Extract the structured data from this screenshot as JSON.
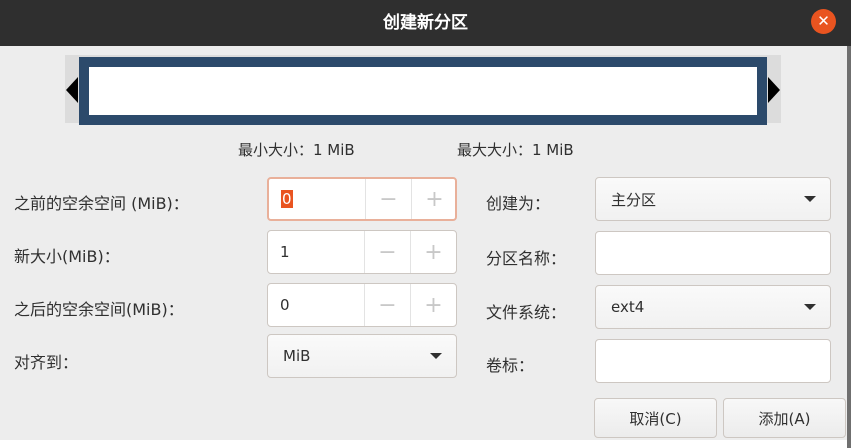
{
  "window": {
    "title": "创建新分区",
    "close_glyph": "✕",
    "accent": "#e95420"
  },
  "size_info": {
    "min": "最小大小：1 MiB",
    "max": "最大大小：1 MiB"
  },
  "fields": {
    "free_before": {
      "label": "之前的空余空间 (MiB)：",
      "value": "0",
      "minus": "−",
      "plus": "+"
    },
    "new_size": {
      "label": "新大小(MiB)：",
      "value": "1",
      "minus": "−",
      "plus": "+"
    },
    "free_after": {
      "label": "之后的空余空间(MiB)：",
      "value": "0",
      "minus": "−",
      "plus": "+"
    },
    "align_to": {
      "label": "对齐到：",
      "value": "MiB",
      "options": [
        "MiB"
      ]
    },
    "create_as": {
      "label": "创建为：",
      "value": "主分区",
      "options": [
        "主分区"
      ]
    },
    "partition_name": {
      "label": "分区名称：",
      "value": ""
    },
    "file_system": {
      "label": "文件系统：",
      "value": "ext4",
      "options": [
        "ext4"
      ]
    },
    "volume_label": {
      "label": "卷标：",
      "value": ""
    }
  },
  "buttons": {
    "cancel": "取消(C)",
    "add": "添加(A)"
  },
  "colors": {
    "titlebar": "#2f2f2f",
    "partition_bar": "#2c4a6b",
    "dialog_bg": "#ededed"
  }
}
